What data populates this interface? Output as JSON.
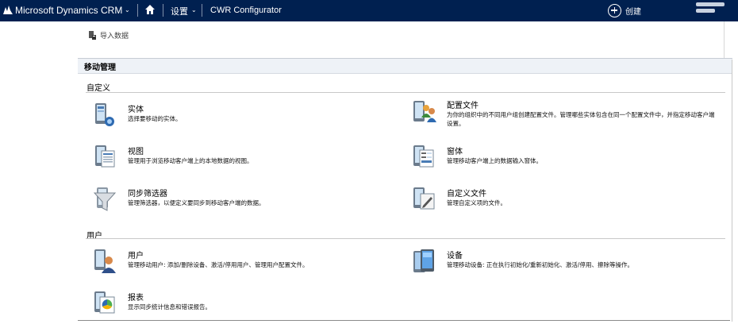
{
  "topbar": {
    "app_title": "Microsoft Dynamics CRM",
    "nav_settings": "设置",
    "nav_current": "CWR Configurator",
    "create_label": "创建",
    "background": "#002050"
  },
  "command_bar": {
    "import_label": "导入数据"
  },
  "section": {
    "title": "移动管理"
  },
  "groups": {
    "customize": {
      "title": "自定义",
      "items": [
        {
          "title": "实体",
          "desc": "选择要移动的实体。",
          "icon": "entity-icon"
        },
        {
          "title": "配置文件",
          "desc": "为你的组织中的不同用户组创建配置文件。管理哪些实体包含在同一个配置文件中，并指定移动客户端设置。",
          "icon": "profile-icon"
        },
        {
          "title": "视图",
          "desc": "管理用于浏览移动客户端上的本地数据的视图。",
          "icon": "view-icon"
        },
        {
          "title": "窗体",
          "desc": "管理移动客户端上的数据输入窗体。",
          "icon": "form-icon"
        },
        {
          "title": "同步筛选器",
          "desc": "管理筛选器，以便定义要同步到移动客户端的数据。",
          "icon": "filter-icon"
        },
        {
          "title": "自定义文件",
          "desc": "管理自定义项的文件。",
          "icon": "custom-file-icon"
        }
      ]
    },
    "users": {
      "title": "用户",
      "items": [
        {
          "title": "用户",
          "desc": "管理移动用户: 添加/删除设备、激活/停用用户、管理用户配置文件。",
          "icon": "user-icon"
        },
        {
          "title": "设备",
          "desc": "管理移动设备: 正在执行初始化/重新初始化、激活/停用、擦除等操作。",
          "icon": "device-icon"
        },
        {
          "title": "报表",
          "desc": "显示同步统计信息和错误报告。",
          "icon": "report-icon"
        }
      ]
    }
  }
}
